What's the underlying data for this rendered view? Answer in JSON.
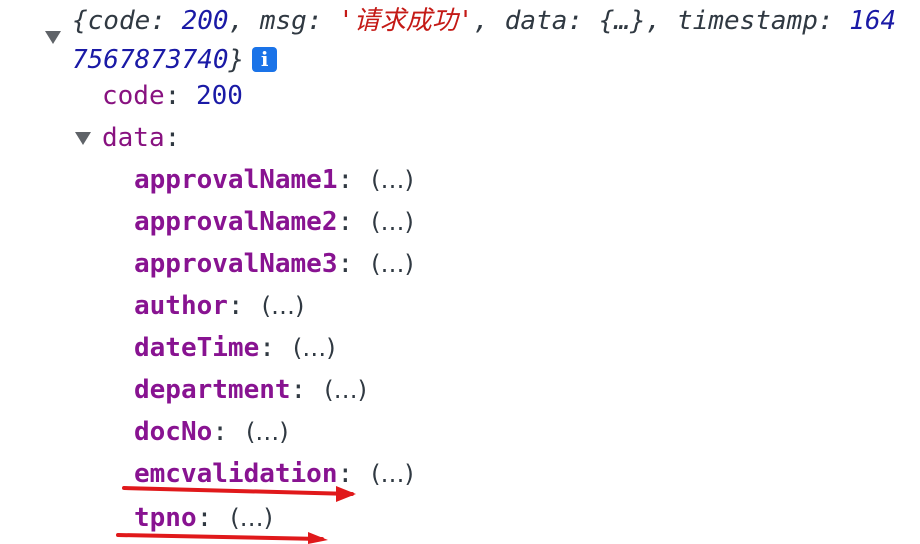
{
  "summary": {
    "open": "{",
    "code_key": "code",
    "sep1": ": ",
    "code_value": "200",
    "comma1": ", ",
    "msg_key": "msg",
    "sep2": ": ",
    "msg_value": "'请求成功'",
    "comma2": ", ",
    "data_key": "data",
    "sep3": ": ",
    "data_preview": "{…}",
    "comma3": ", ",
    "timestamp_key": "timestamp",
    "sep4": ": ",
    "timestamp_value": "1647567873740",
    "close": "}",
    "info_icon_glyph": "i"
  },
  "code_row": {
    "key": "code",
    "colon": ":",
    "value": "200"
  },
  "data_row": {
    "key": "data",
    "colon": ":"
  },
  "data_props": [
    {
      "key": "approvalName1",
      "colon": ":",
      "value": "(…)"
    },
    {
      "key": "approvalName2",
      "colon": ":",
      "value": "(…)"
    },
    {
      "key": "approvalName3",
      "colon": ":",
      "value": "(…)"
    },
    {
      "key": "author",
      "colon": ":",
      "value": "(…)"
    },
    {
      "key": "dateTime",
      "colon": ":",
      "value": "(…)"
    },
    {
      "key": "department",
      "colon": ":",
      "value": "(…)"
    },
    {
      "key": "docNo",
      "colon": ":",
      "value": "(…)"
    },
    {
      "key": "emcvalidation",
      "colon": ":",
      "value": "(…)"
    },
    {
      "key": "tpno",
      "colon": ":",
      "value": "(…)"
    }
  ],
  "colors": {
    "property": "#881391",
    "number": "#1a1aa6",
    "string": "#c41a16",
    "annotation_arrow": "#e0191b",
    "info_icon": "#1a73e8"
  },
  "icons": {
    "summary_toggle": "triangle-down-icon",
    "data_toggle": "triangle-down-icon",
    "info": "info-icon"
  }
}
